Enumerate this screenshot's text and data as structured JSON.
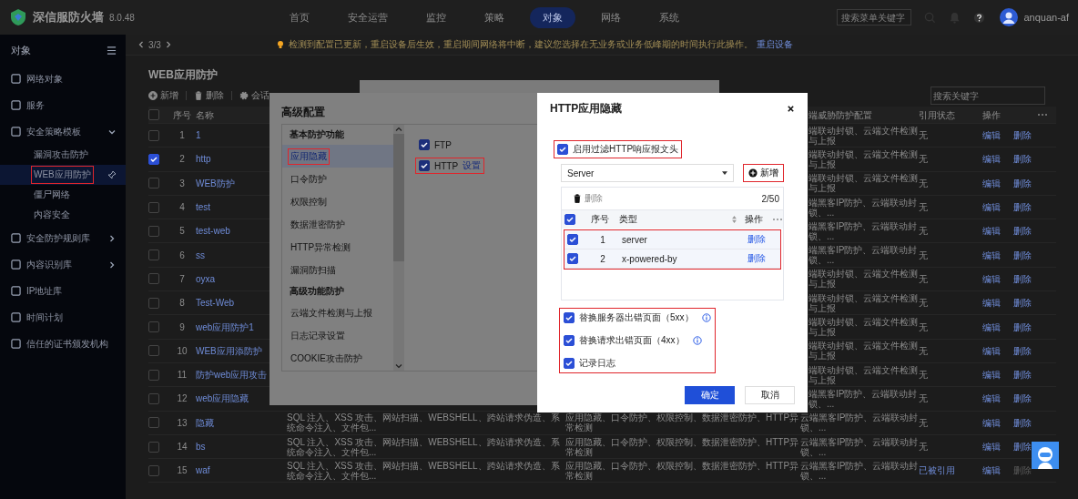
{
  "top_bar": {
    "product": "深信服防火墙",
    "version": "8.0.48",
    "nav": [
      {
        "label": "首页",
        "selected": false
      },
      {
        "label": "安全运营",
        "selected": false
      },
      {
        "label": "监控",
        "selected": false
      },
      {
        "label": "策略",
        "selected": false
      },
      {
        "label": "对象",
        "selected": true
      },
      {
        "label": "网络",
        "selected": false
      },
      {
        "label": "系统",
        "selected": false
      }
    ],
    "search": {
      "placeholder": "搜索菜单关键字"
    },
    "user": "anquan-af"
  },
  "notice_bar": {
    "pager": "3/3",
    "message": "检测到配置已更新，重启设备后生效，重启期间网络将中断，建议您选择在无业务或业务低峰期的时间执行此操作。",
    "link": "重启设备"
  },
  "sidebar": {
    "title": "对象",
    "items": [
      {
        "label": "网络对象",
        "kind": "leaf"
      },
      {
        "label": "服务",
        "kind": "leaf"
      },
      {
        "label": "安全策略模板",
        "kind": "folder",
        "expanded": true,
        "children": [
          {
            "label": "漏洞攻击防护",
            "selected": false,
            "red_box": false
          },
          {
            "label": "WEB应用防护",
            "selected": true,
            "red_box": true
          },
          {
            "label": "僵尸网络",
            "selected": false,
            "red_box": false
          },
          {
            "label": "内容安全",
            "selected": false,
            "red_box": false
          }
        ]
      },
      {
        "label": "安全防护规则库",
        "kind": "folder",
        "expanded": false
      },
      {
        "label": "内容识别库",
        "kind": "folder",
        "expanded": false
      },
      {
        "label": "IP地址库",
        "kind": "leaf"
      },
      {
        "label": "时间计划",
        "kind": "leaf"
      },
      {
        "label": "信任的证书颁发机构",
        "kind": "leaf"
      }
    ]
  },
  "page": {
    "title": "WEB应用防护",
    "toolbar": [
      {
        "label": "新增",
        "kind": "add"
      },
      {
        "label": "删除",
        "kind": "delete"
      },
      {
        "label": "会话",
        "kind": "settings"
      }
    ],
    "search": {
      "placeholder": "搜索关键字"
    },
    "table": {
      "header": {
        "index": "序号",
        "name": "名称",
        "column_6": "端威胁防护配置",
        "status": "引用状态",
        "actions": "操作"
      },
      "all_checked": false,
      "rows": [
        {
          "index": "1",
          "name": "1",
          "column_6": "端联动封锁、云端文件检测与上报",
          "status": "无",
          "referenced": false,
          "checked": false,
          "edit": "编辑",
          "delete": "删除"
        },
        {
          "index": "2",
          "name": "http",
          "column_6": "端联动封锁、云端文件检测与上报",
          "status": "无",
          "referenced": false,
          "checked": true,
          "edit": "编辑",
          "delete": "删除"
        },
        {
          "index": "3",
          "name": "WEB防护",
          "column_6": "端联动封锁、云端文件检测与上报",
          "status": "无",
          "referenced": false,
          "checked": false,
          "edit": "编辑",
          "delete": "删除"
        },
        {
          "index": "4",
          "name": "test",
          "column_6": "端黑客IP防护、云端联动封锁、...",
          "status": "无",
          "referenced": false,
          "checked": false,
          "edit": "编辑",
          "delete": "删除"
        },
        {
          "index": "5",
          "name": "test-web",
          "column_6": "端黑客IP防护、云端联动封锁、...",
          "status": "无",
          "referenced": false,
          "checked": false,
          "edit": "编辑",
          "delete": "删除"
        },
        {
          "index": "6",
          "name": "ss",
          "column_6": "端黑客IP防护、云端联动封锁、...",
          "status": "无",
          "referenced": false,
          "checked": false,
          "edit": "编辑",
          "delete": "删除"
        },
        {
          "index": "7",
          "name": "oyxa",
          "column_6": "端联动封锁、云端文件检测与上报",
          "status": "无",
          "referenced": false,
          "checked": false,
          "edit": "编辑",
          "delete": "删除"
        },
        {
          "index": "8",
          "name": "Test-Web",
          "column_6": "端联动封锁、云端文件检测与上报",
          "status": "无",
          "referenced": false,
          "checked": false,
          "edit": "编辑",
          "delete": "删除"
        },
        {
          "index": "9",
          "name": "web应用防护1",
          "column_6": "端联动封锁、云端文件检测与上报",
          "status": "无",
          "referenced": false,
          "checked": false,
          "edit": "编辑",
          "delete": "删除"
        },
        {
          "index": "10",
          "name": "WEB应用添防护",
          "column_6": "端联动封锁、云端文件检测与上报",
          "status": "无",
          "referenced": false,
          "checked": false,
          "edit": "编辑",
          "delete": "删除"
        },
        {
          "index": "11",
          "name": "防护web应用攻击",
          "column_6": "端联动封锁、云端文件检测与上报",
          "status": "无",
          "referenced": false,
          "checked": false,
          "edit": "编辑",
          "delete": "删除"
        },
        {
          "index": "12",
          "name": "web应用隐藏",
          "column_6": "端黑客IP防护、云端联动封锁、...",
          "status": "无",
          "referenced": false,
          "checked": false,
          "edit": "编辑",
          "delete": "删除"
        },
        {
          "index": "13",
          "name": "隐藏",
          "column_4": "SQL 注入、XSS 攻击、网站扫描、WEBSHELL、跨站请求伪造、系统命令注入、文件包...",
          "column_5": "应用隐藏、口令防护、权限控制、数据泄密防护、HTTP异常检测",
          "column_6": "云端黑客IP防护、云端联动封锁、...",
          "status": "无",
          "referenced": false,
          "checked": false,
          "edit": "编辑",
          "delete": "删除"
        },
        {
          "index": "14",
          "name": "bs",
          "column_4": "SQL 注入、XSS 攻击、网站扫描、WEBSHELL、跨站请求伪造、系统命令注入、文件包...",
          "column_5": "应用隐藏、口令防护、权限控制、数据泄密防护、HTTP异常检测",
          "column_6": "云端黑客IP防护、云端联动封锁、...",
          "status": "无",
          "referenced": false,
          "checked": false,
          "edit": "编辑",
          "delete": "删除"
        },
        {
          "index": "15",
          "name": "waf",
          "column_4": "SQL 注入、XSS 攻击、网站扫描、WEBSHELL、跨站请求伪造、系统命令注入、文件包...",
          "column_5": "应用隐藏、口令防护、权限控制、数据泄密防护、HTTP异常检测",
          "column_6": "云端黑客IP防护、云端联动封锁、...",
          "status": "已被引用",
          "referenced": true,
          "checked": false,
          "edit": "编辑",
          "delete": "删除"
        }
      ]
    }
  },
  "advanced_dialog": {
    "title": "高级配置",
    "sections": [
      {
        "heading": "基本防护功能",
        "items": [
          {
            "label": "应用隐藏",
            "selected": true,
            "red_box": true
          },
          {
            "label": "口令防护",
            "selected": false,
            "red_box": false
          },
          {
            "label": "权限控制",
            "selected": false,
            "red_box": false
          },
          {
            "label": "数据泄密防护",
            "selected": false,
            "red_box": false
          },
          {
            "label": "HTTP异常检测",
            "selected": false,
            "red_box": false
          },
          {
            "label": "漏洞防扫描",
            "selected": false,
            "red_box": false
          }
        ]
      },
      {
        "heading": "高级功能防护",
        "items": [
          {
            "label": "云端文件检测与上报",
            "selected": false,
            "red_box": false
          },
          {
            "label": "日志记录设置",
            "selected": false,
            "red_box": false
          },
          {
            "label": "COOKIE攻击防护",
            "selected": false,
            "red_box": false
          }
        ]
      }
    ],
    "protocols": [
      {
        "label": "FTP",
        "checked": true,
        "red_box": false
      },
      {
        "label": "HTTP",
        "checked": true,
        "link": "设置",
        "red_box": true
      }
    ]
  },
  "http_dialog": {
    "title": "HTTP应用隐藏",
    "enable": {
      "label": "启用过滤HTTP响应报文头",
      "checked": true,
      "red_box": true
    },
    "select": {
      "value": "Server"
    },
    "add_button": {
      "label": "新增",
      "red_box": true
    },
    "table": {
      "delete": "删除",
      "count": "2/50",
      "all_checked": true,
      "header": {
        "index": "序号",
        "type": "类型",
        "action": "操作"
      },
      "rows_red_box": true,
      "rows": [
        {
          "index": "1",
          "type": "server",
          "action": "删除",
          "checked": true
        },
        {
          "index": "2",
          "type": "x-powered-by",
          "action": "删除",
          "checked": true
        }
      ]
    },
    "options_red_box": true,
    "options": [
      {
        "label": "替换服务器出错页面（5xx）",
        "checked": true,
        "info": true
      },
      {
        "label": "替换请求出错页面（4xx）",
        "checked": true,
        "info": true
      },
      {
        "label": "记录日志",
        "checked": true,
        "info": false
      }
    ],
    "buttons": [
      {
        "label": "确定",
        "kind": "primary"
      },
      {
        "label": "取消",
        "kind": "default"
      }
    ]
  }
}
